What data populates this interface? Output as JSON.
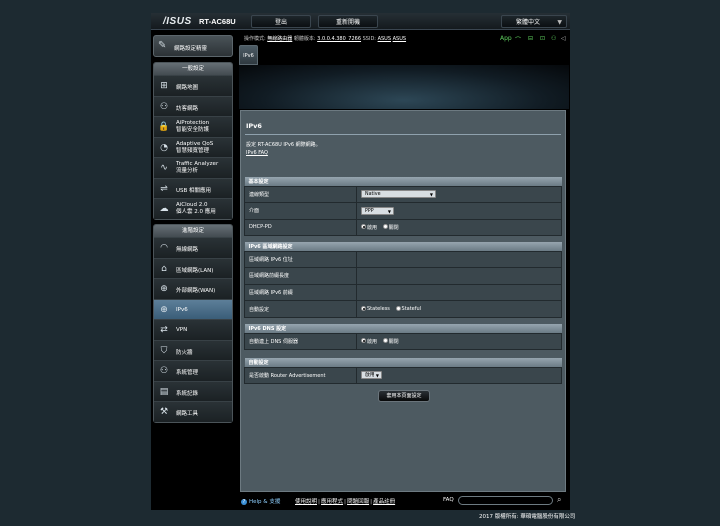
{
  "header": {
    "logo": "/ISUS",
    "model": "RT-AC68U",
    "logout": "登出",
    "reboot": "重新開機",
    "language": "繁體中文"
  },
  "status_bar": {
    "mode_label": "操作模式:",
    "mode_value": "無線路由器",
    "fw_label": "韌體版本:",
    "fw_value": "3.0.0.4.380_7266",
    "ssid_label": "SSID:",
    "ssid_value": "ASUS",
    "ssid_5g": "ASUS",
    "app_label": "App"
  },
  "sidebar": {
    "qis_label": "網路設定精靈",
    "general_title": "一般設定",
    "general_items": [
      {
        "icon": "network-map-icon",
        "glyph": "⊞",
        "label": "網路地圖"
      },
      {
        "icon": "guest-network-icon",
        "glyph": "⚇",
        "label": "訪客網路"
      },
      {
        "icon": "aiprotection-icon",
        "glyph": "🔒",
        "label": "AiProtection",
        "sub": "智能安全防護"
      },
      {
        "icon": "qos-icon",
        "glyph": "◔",
        "label": "Adaptive QoS",
        "sub": "智慧頻寬管理"
      },
      {
        "icon": "traffic-analyzer-icon",
        "glyph": "∿",
        "label": "Traffic Analyzer",
        "sub": "流量分析"
      },
      {
        "icon": "usb-icon",
        "glyph": "⇌",
        "label": "USB 相關應用"
      },
      {
        "icon": "aicloud-icon",
        "glyph": "☁",
        "label": "AiCloud 2.0",
        "sub": "個人雲 2.0 應用"
      }
    ],
    "advanced_title": "進階設定",
    "advanced_items": [
      {
        "icon": "wireless-icon",
        "glyph": "◠",
        "label": "無線網路"
      },
      {
        "icon": "lan-icon",
        "glyph": "⌂",
        "label": "區域網路(LAN)"
      },
      {
        "icon": "wan-icon",
        "glyph": "⊕",
        "label": "外部網路(WAN)"
      },
      {
        "icon": "ipv6-icon",
        "glyph": "⊕",
        "label": "IPv6",
        "active": true
      },
      {
        "icon": "vpn-icon",
        "glyph": "⇄",
        "label": "VPN"
      },
      {
        "icon": "firewall-icon",
        "glyph": "⛉",
        "label": "防火牆"
      },
      {
        "icon": "administration-icon",
        "glyph": "⚇",
        "label": "系統管理"
      },
      {
        "icon": "system-log-icon",
        "glyph": "▤",
        "label": "系統記錄"
      },
      {
        "icon": "network-tools-icon",
        "glyph": "⚒",
        "label": "網路工具"
      }
    ]
  },
  "tab": {
    "label": "IPv6"
  },
  "panel": {
    "title": "IPv6",
    "description": "設定 RT-AC68U IPv6 網際網路。",
    "faq": "IPv6 FAQ",
    "sections": {
      "basic": "基本設定",
      "lan": "IPv6 區域網路設定",
      "dns": "IPv6 DNS 設定",
      "auto": "自動設定"
    },
    "rows": {
      "conn_type_label": "連線類型",
      "conn_type_value": "Native",
      "interface_label": "介面",
      "interface_value": "PPP",
      "dhcp_pd_label": "DHCP-PD",
      "enable": "啟用",
      "disable": "關閉",
      "lan_ipv6_addr_label": "區域網路 IPv6 位址",
      "lan_prefix_len_label": "區域網路前綴長度",
      "lan_prefix_label": "區域網路 IPv6 前綴",
      "autoconf_label": "自動設定",
      "stateless": "Stateless",
      "stateful": "Stateful",
      "dns_auto_label": "自動連上 DNS 伺服器",
      "router_adv_label": "是否啟動 Router Advertisement",
      "router_adv_value": "啟用"
    },
    "apply": "套用本頁面設定"
  },
  "footer": {
    "help": "Help & 支援",
    "links": [
      "使用說明",
      "應用程式",
      "問題回報",
      "產品註冊"
    ],
    "faq": "FAQ"
  },
  "copyright": "2017 版權所有: 華碩電腦股份有限公司"
}
